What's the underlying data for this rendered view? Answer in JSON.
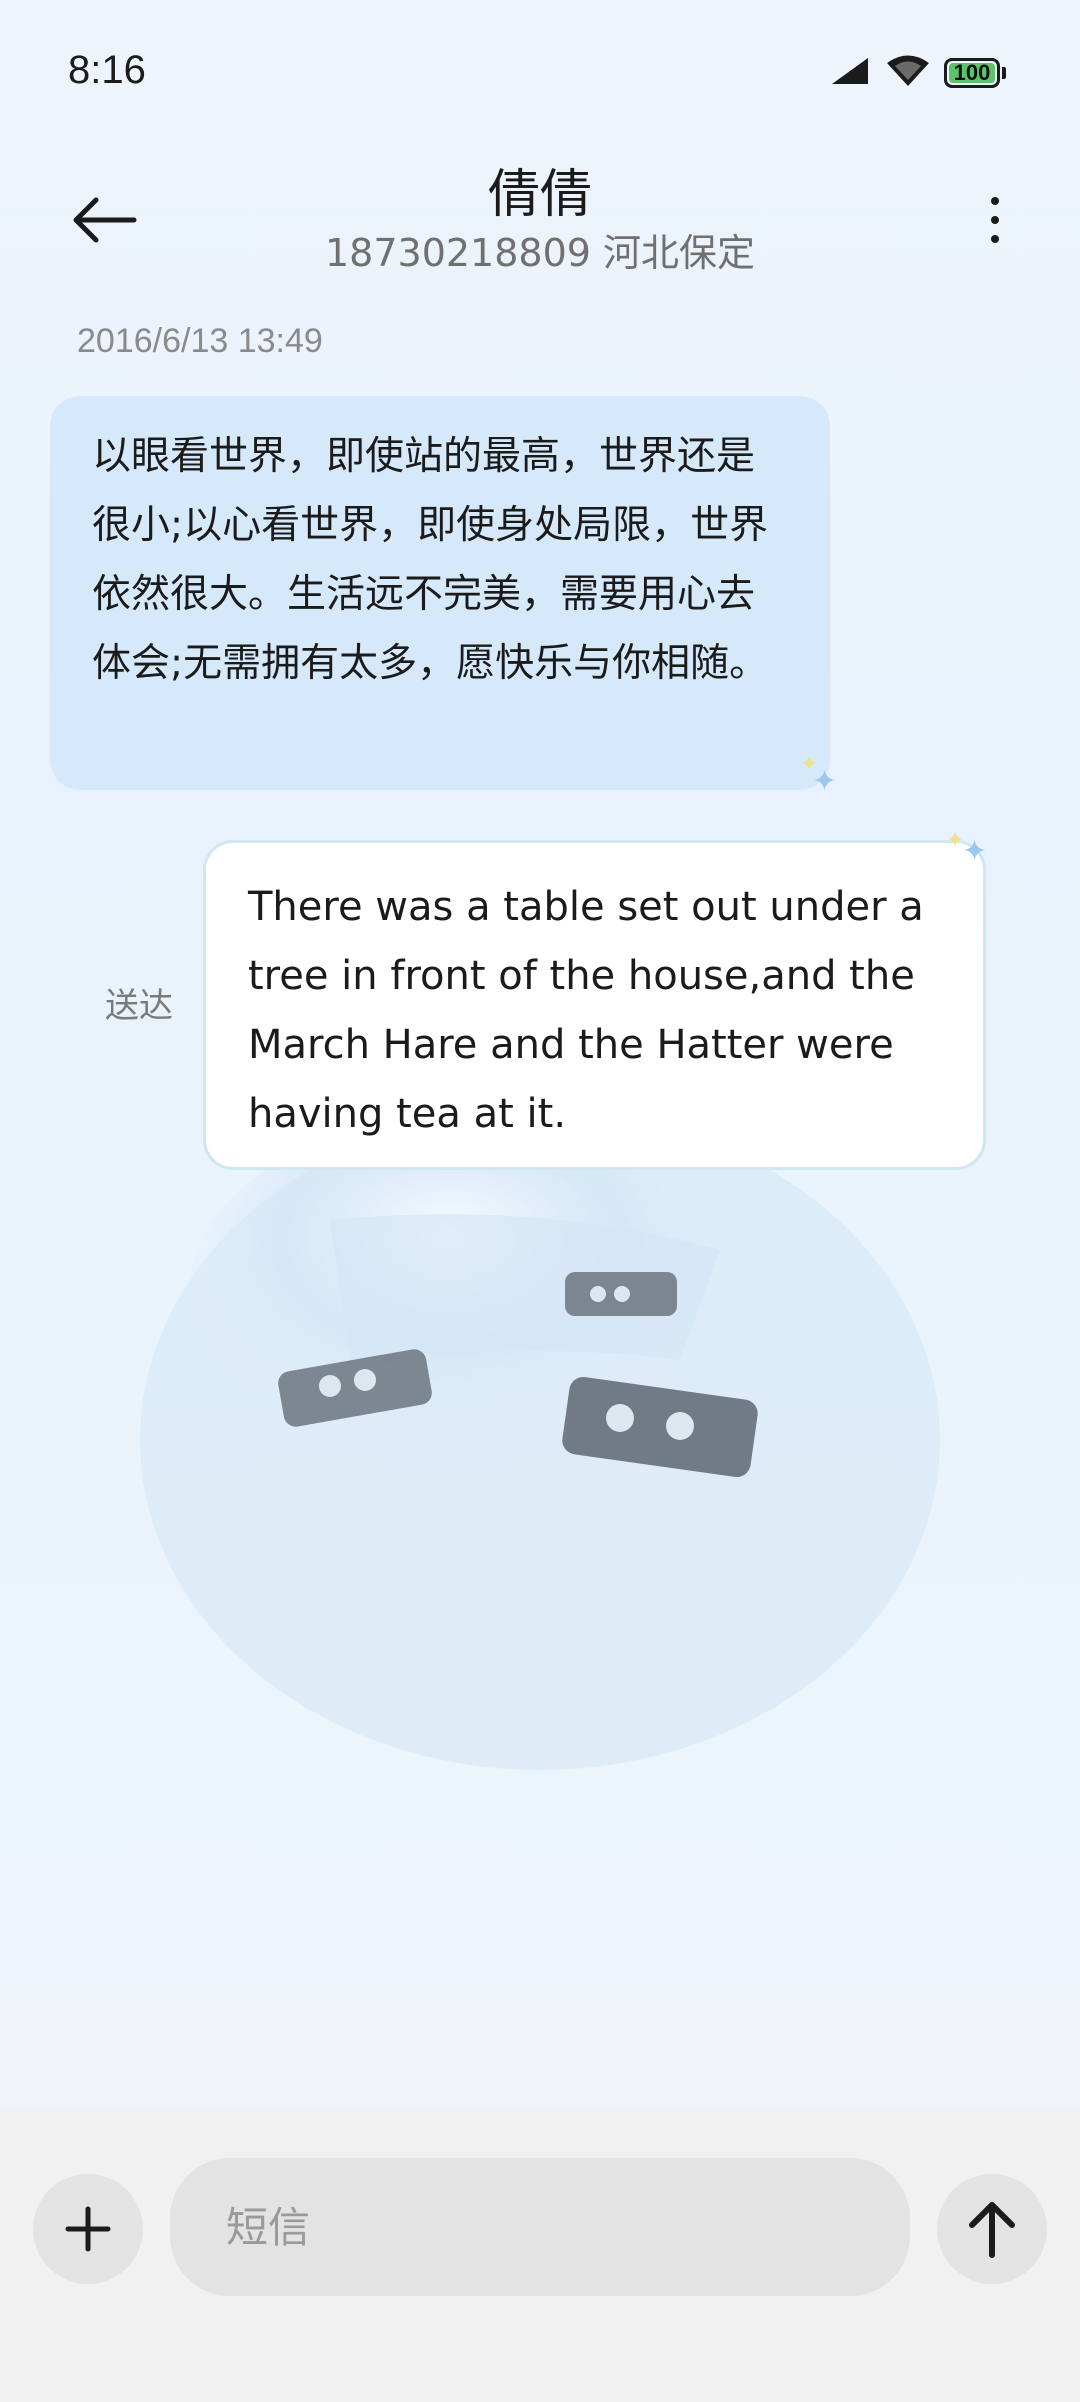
{
  "status_bar": {
    "time": "8:16",
    "battery_level": "100",
    "icons": [
      "signal-icon",
      "wifi-icon",
      "battery-icon"
    ]
  },
  "header": {
    "contact_name": "倩倩",
    "contact_detail": "18730218809 河北保定",
    "icons": [
      "back-arrow-icon",
      "more-vertical-icon"
    ]
  },
  "conversation": {
    "timestamp": "2016/6/13 13:49",
    "messages": [
      {
        "direction": "incoming",
        "text": "以眼看世界，即使站的最高，世界还是很小;以心看世界，即使身处局限，世界依然很大。生活远不完美，需要用心去体会;无需拥有太多，愿快乐与你相随。"
      },
      {
        "direction": "outgoing",
        "status": "送达",
        "text": "There was a table set out under a tree in front of the house,and the March Hare and the Hatter were having tea at it."
      }
    ]
  },
  "composer": {
    "placeholder": "短信",
    "value": "",
    "icons": [
      "plus-icon",
      "send-arrow-up-icon"
    ]
  },
  "colors": {
    "incoming_bubble": "#d6e9fb",
    "outgoing_bubble": "#ffffff",
    "outgoing_border": "#cfe7ee",
    "battery_fill": "#5cc36b"
  }
}
